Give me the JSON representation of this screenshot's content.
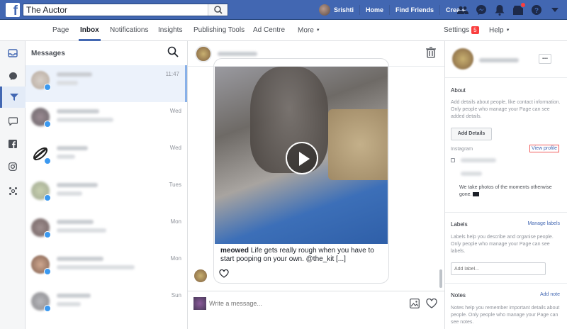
{
  "topbar": {
    "search_value": "The Auctor",
    "user_name": "Srishti",
    "nav_home": "Home",
    "nav_find_friends": "Find Friends",
    "nav_create": "Create",
    "brand_color": "#4267b2"
  },
  "subnav": {
    "tabs": [
      "Page",
      "Inbox",
      "Notifications",
      "Insights",
      "Publishing Tools",
      "Ad Centre",
      "More"
    ],
    "active_tab": "Inbox",
    "settings": "Settings",
    "settings_count": "5",
    "help": "Help"
  },
  "conversations": {
    "title": "Messages",
    "items": [
      {
        "time": "11:47",
        "selected": true
      },
      {
        "time": "Wed"
      },
      {
        "time": "Wed"
      },
      {
        "time": "Tues"
      },
      {
        "time": "Mon"
      },
      {
        "time": "Mon"
      },
      {
        "time": "Sun"
      }
    ]
  },
  "chat": {
    "caption_user": "meowed",
    "caption_text": "Life gets really rough when you have to start pooping on your own.",
    "caption_tail": "@the_kit [...]",
    "composer_placeholder": "Write a message..."
  },
  "info": {
    "about_title": "About",
    "about_text": "Add details about people, like contact information. Only people who manage your Page can see added details.",
    "add_details": "Add Details",
    "instagram_label": "Instagram",
    "view_profile": "View profile",
    "instagram_bio": "We take photos of the moments otherwise gone.",
    "labels_title": "Labels",
    "manage_labels": "Manage labels",
    "labels_text": "Labels help you describe and organise people. Only people who manage your Page can see labels.",
    "add_label_placeholder": "Add label...",
    "notes_title": "Notes",
    "add_note": "Add note",
    "notes_text": "Notes help you remember important details about people. Only people who manage your Page can see notes."
  }
}
